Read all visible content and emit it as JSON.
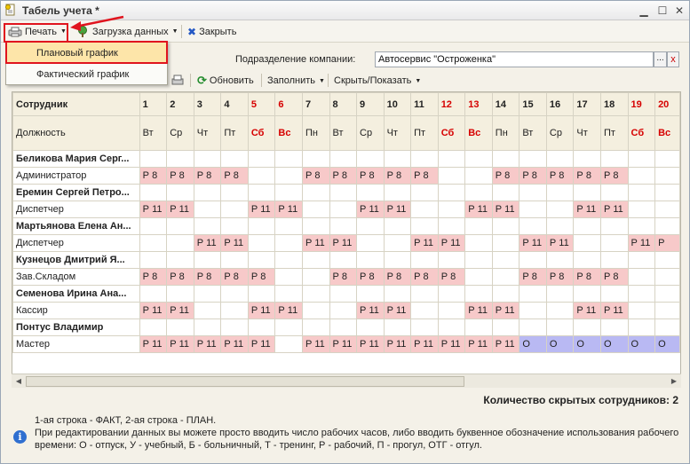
{
  "window": {
    "title": "Табель учета *"
  },
  "toolbar": {
    "print_label": "Печать",
    "load_label": "Загрузка данных",
    "close_label": "Закрыть"
  },
  "print_menu": {
    "items": [
      "Плановый график",
      "Фактический график"
    ]
  },
  "filter": {
    "subdivision_label": "Подразделение компании:",
    "subdivision_value": "Автосервис \"Остроженка\"",
    "more_btn": "...",
    "clear_btn": "x"
  },
  "toolbar2": {
    "refresh_label": "Обновить",
    "fill_label": "Заполнить",
    "showhide_label": "Скрыть/Показать"
  },
  "grid": {
    "col_employee": "Сотрудник",
    "col_position": "Должность",
    "days": [
      "1",
      "2",
      "3",
      "4",
      "5",
      "6",
      "7",
      "8",
      "9",
      "10",
      "11",
      "12",
      "13",
      "14",
      "15",
      "16",
      "17",
      "18",
      "19",
      "20"
    ],
    "weekdays": [
      "Вт",
      "Ср",
      "Чт",
      "Пт",
      "Сб",
      "Вс",
      "Пн",
      "Вт",
      "Ср",
      "Чт",
      "Пт",
      "Сб",
      "Вс",
      "Пн",
      "Вт",
      "Ср",
      "Чт",
      "Пт",
      "Сб",
      "Вс"
    ],
    "weekend_idx": [
      4,
      5,
      11,
      12,
      18,
      19
    ],
    "employees": [
      {
        "name": "Беликова Мария Серг...",
        "position": "Администратор",
        "plan": [
          "Р 8",
          "Р 8",
          "Р 8",
          "Р 8",
          "",
          "",
          "Р 8",
          "Р 8",
          "Р 8",
          "Р 8",
          "Р 8",
          "",
          "",
          "Р 8",
          "Р 8",
          "Р 8",
          "Р 8",
          "Р 8",
          "",
          ""
        ]
      },
      {
        "name": "Еремин Сергей Петро...",
        "position": "Диспетчер",
        "plan": [
          "Р 11",
          "Р 11",
          "",
          "",
          "Р 11",
          "Р 11",
          "",
          "",
          "Р 11",
          "Р 11",
          "",
          "",
          "Р 11",
          "Р 11",
          "",
          "",
          "Р 11",
          "Р 11",
          "",
          ""
        ]
      },
      {
        "name": "Мартьянова Елена Ан...",
        "position": "Диспетчер",
        "plan": [
          "",
          "",
          "Р 11",
          "Р 11",
          "",
          "",
          "Р 11",
          "Р 11",
          "",
          "",
          "Р 11",
          "Р 11",
          "",
          "",
          "Р 11",
          "Р 11",
          "",
          "",
          "Р 11",
          "Р"
        ]
      },
      {
        "name": "Кузнецов Дмитрий Я...",
        "position": "Зав.Складом",
        "plan": [
          "Р 8",
          "Р 8",
          "Р 8",
          "Р 8",
          "Р 8",
          "",
          "",
          "Р 8",
          "Р 8",
          "Р 8",
          "Р 8",
          "Р 8",
          "",
          "",
          "Р 8",
          "Р 8",
          "Р 8",
          "Р 8",
          "",
          ""
        ]
      },
      {
        "name": "Семенова Ирина Ана...",
        "position": "Кассир",
        "plan": [
          "Р 11",
          "Р 11",
          "",
          "",
          "Р 11",
          "Р 11",
          "",
          "",
          "Р 11",
          "Р 11",
          "",
          "",
          "Р 11",
          "Р 11",
          "",
          "",
          "Р 11",
          "Р 11",
          "",
          ""
        ]
      },
      {
        "name": "Понтус Владимир",
        "position": "Мастер",
        "plan": [
          "Р 11",
          "Р 11",
          "Р 11",
          "Р 11",
          "Р 11",
          "",
          "Р 11",
          "Р 11",
          "Р 11",
          "Р 11",
          "Р 11",
          "Р 11",
          "Р 11",
          "Р 11",
          "О",
          "О",
          "О",
          "О",
          "О",
          "О"
        ]
      }
    ]
  },
  "status": {
    "hidden_count": "Количество скрытых сотрудников: 2"
  },
  "info": {
    "line1": "1-ая строка - ФАКТ, 2-ая строка - ПЛАН.",
    "line2": "При редактировании данных вы можете просто вводить число рабочих часов, либо вводить буквенное обозначение использования рабочего времени: О - отпуск, У - учебный, Б - больничный, Т - тренинг, Р - рабочий, П - прогул, ОТГ - отгул."
  },
  "colors": {
    "plan_cell": "#f7c9c9",
    "vacation_cell": "#b9b9f3",
    "weekend_text": "#d60000",
    "highlight": "#e0141e"
  }
}
